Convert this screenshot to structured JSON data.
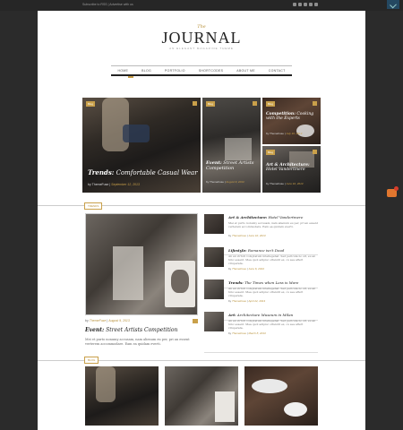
{
  "topbar": {
    "left_text": "Subscribe to RSS | Advertise with us",
    "social_icons": [
      "facebook-icon",
      "twitter-icon",
      "pinterest-icon",
      "instagram-icon",
      "rss-icon"
    ]
  },
  "brand": {
    "prefix": "The",
    "name": "JOURNAL",
    "tagline": "AN ELEGANT MAGAZINE THEME"
  },
  "nav": {
    "items": [
      "HOME",
      "BLOG",
      "PORTFOLIO",
      "SHORTCODES",
      "ABOUT ME",
      "CONTACT"
    ],
    "active": "HOME"
  },
  "featured": [
    {
      "badge": "Blog",
      "title_bold": "Trends:",
      "title_rest": "Comfortable Casual Wear",
      "meta_prefix": "by",
      "author": "ThemeFuse",
      "date": "September 12, 2013"
    },
    {
      "badge": "Blog",
      "title_bold": "Event:",
      "title_rest": "Street Artists Competition",
      "meta_prefix": "by",
      "author": "ThemeFuse",
      "date": "August 9, 2013"
    },
    {
      "badge": "Blog",
      "title_bold": "Competition:",
      "title_rest": "Cooking with the Experts",
      "meta_prefix": "by",
      "author": "ThemeFuse",
      "date": "July 10, 2013"
    },
    {
      "badge": "Blog",
      "title_bold": "Art & Architecture:",
      "title_rest": "Hotel Vandertmere",
      "meta_prefix": "by",
      "author": "ThemeFuse",
      "date": "June 10, 2013"
    }
  ],
  "sections": {
    "trends_label": "TRENDS",
    "blog_label": "BLOG"
  },
  "main_post": {
    "meta_prefix": "by",
    "author": "ThemeFuse",
    "date": "August 9, 2013",
    "headline_bold": "Event:",
    "headline_rest": "Street Artists Competition",
    "excerpt": "Mei et purto nonumy accusam, nam alienum eu per, pri an essent verterem accommodare. Eam ea quidam everti."
  },
  "list_posts": [
    {
      "title_bold": "Art & Architecture:",
      "title_rest": "Hotel Vandertmere",
      "excerpt": "Mei et purto nonumy accusam, nam alienum eu per, pri an essent verterem accommodare. Eam ea quidam everti.",
      "meta_prefix": "by",
      "author": "ThemeFuse",
      "date": "June 10, 2013"
    },
    {
      "title_bold": "Lifestyle:",
      "title_rest": "Romance isn't Dead",
      "excerpt": "An an virtuti voluptatum intellegebat. Sed pericula no sit, eu an hinc essent. Mea quot adipisc offendit ex, cu sea affert vituperata.",
      "meta_prefix": "by",
      "author": "ThemeFuse",
      "date": "June 6, 2013"
    },
    {
      "title_bold": "Trends:",
      "title_rest": "The Times when Less is More",
      "excerpt": "An an virtuti voluptatum intellegebat. Sed pericula no sit, eu an hinc essent. Mea quot adipisc offendit ex, cu sea affert vituperata.",
      "meta_prefix": "by",
      "author": "ThemeFuse",
      "date": "April 22, 2013"
    },
    {
      "title_bold": "Art:",
      "title_rest": "Architecture Museum in Milan",
      "excerpt": "An an virtuti voluptatum intellegebat. Sed pericula no sit, eu an hinc essent. Mea quot adipisc offendit ex, cu sea affert vituperata.",
      "meta_prefix": "by",
      "author": "ThemeFuse",
      "date": "March 8, 2013"
    }
  ],
  "colors": {
    "accent": "#c9a04a",
    "background": "#2b2b2b",
    "page": "#ffffff"
  }
}
